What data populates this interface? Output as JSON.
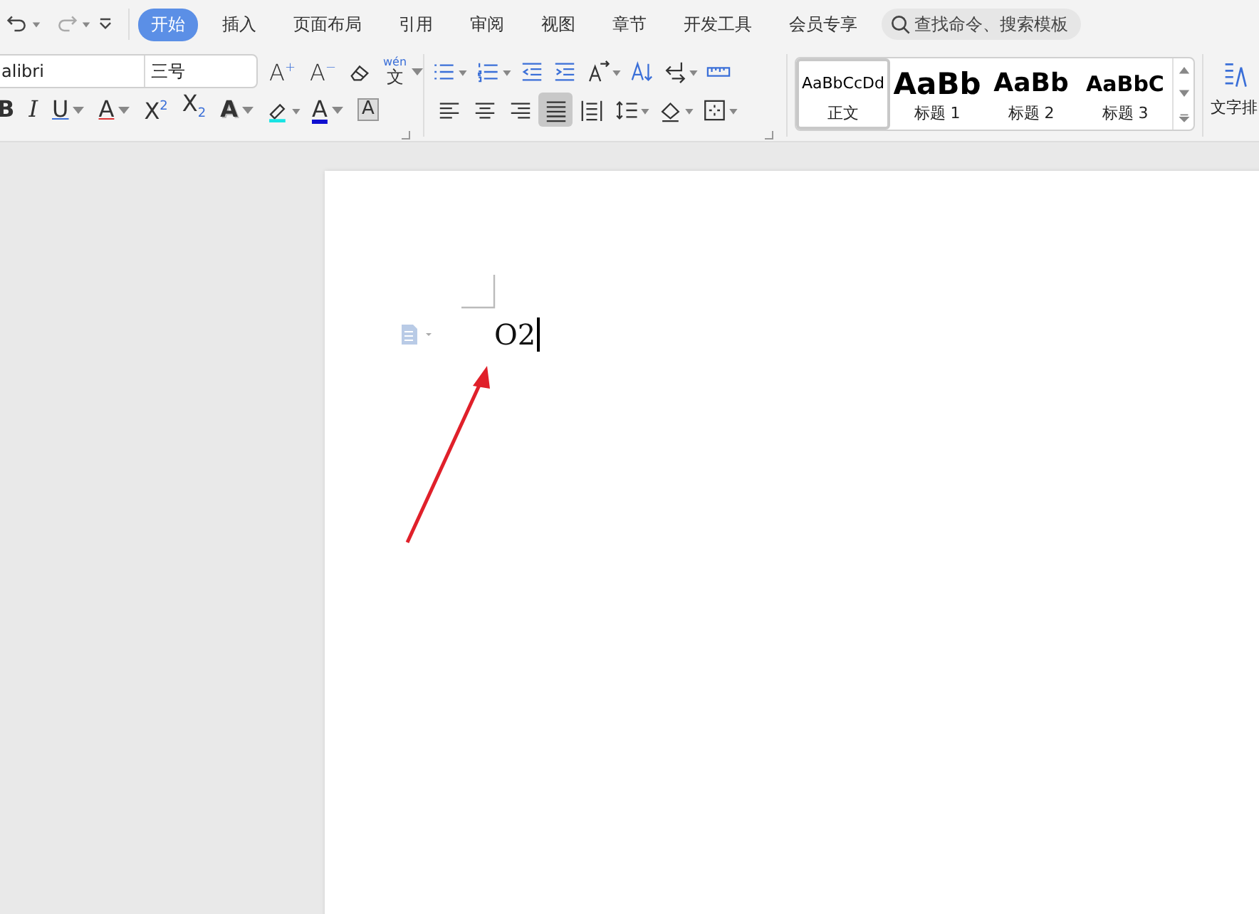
{
  "tabs": [
    {
      "label": "开始",
      "selected": true
    },
    {
      "label": "插入",
      "selected": false
    },
    {
      "label": "页面布局",
      "selected": false
    },
    {
      "label": "引用",
      "selected": false
    },
    {
      "label": "审阅",
      "selected": false
    },
    {
      "label": "视图",
      "selected": false
    },
    {
      "label": "章节",
      "selected": false
    },
    {
      "label": "开发工具",
      "selected": false
    },
    {
      "label": "会员专享",
      "selected": false
    }
  ],
  "search": {
    "placeholder": "查找命令、搜索模板"
  },
  "font": {
    "name": "alibri",
    "size": "三号"
  },
  "font_tools": [
    {
      "kind": "grow",
      "glyph": "A$^{+}$",
      "dropdown": false
    },
    {
      "kind": "shrink",
      "glyph": "A$^{−}$",
      "dropdown": false
    },
    {
      "kind": "eraser",
      "dropdown": false
    },
    {
      "kind": "phonetic",
      "top": "wén",
      "glyph": "文",
      "dropdown": true
    }
  ],
  "format_tools": [
    {
      "kind": "bold",
      "glyph": "B",
      "dropdown": false
    },
    {
      "kind": "italic",
      "glyph": "I",
      "dropdown": false
    },
    {
      "kind": "underline",
      "glyph": "U",
      "dropdown": true
    },
    {
      "kind": "strike",
      "glyph": "A",
      "dropdown": true
    },
    {
      "kind": "sup",
      "glyph": "X$^{2}$",
      "dropdown": false
    },
    {
      "kind": "sub",
      "glyph": "X$_{2}$",
      "dropdown": false
    },
    {
      "kind": "outline",
      "glyph": "A",
      "dropdown": true
    },
    {
      "kind": "highlight",
      "dropdown": true
    },
    {
      "kind": "color",
      "glyph": "A",
      "dropdown": true
    },
    {
      "kind": "shade",
      "glyph": "A",
      "dropdown": false
    }
  ],
  "paragraph_tools": [
    {
      "kind": "bullets",
      "dropdown": true
    },
    {
      "kind": "numbering",
      "dropdown": true
    },
    {
      "kind": "outdent",
      "dropdown": false
    },
    {
      "kind": "indent",
      "dropdown": false
    },
    {
      "kind": "direction",
      "dropdown": true
    },
    {
      "kind": "sort",
      "dropdown": false
    },
    {
      "kind": "linebreak",
      "dropdown": true
    },
    {
      "kind": "ruler",
      "dropdown": false
    }
  ],
  "align_tools": [
    {
      "kind": "left",
      "selected": false,
      "dropdown": false
    },
    {
      "kind": "center",
      "selected": false,
      "dropdown": false
    },
    {
      "kind": "right",
      "selected": false,
      "dropdown": false
    },
    {
      "kind": "justify",
      "selected": true,
      "dropdown": false
    },
    {
      "kind": "distribute",
      "selected": false,
      "dropdown": false
    },
    {
      "kind": "spacing",
      "selected": false,
      "dropdown": true
    },
    {
      "kind": "fill",
      "selected": false,
      "dropdown": true
    },
    {
      "kind": "border",
      "selected": false,
      "dropdown": true
    }
  ],
  "styles": [
    {
      "kind": "body",
      "sample": "AaBbCcDd",
      "label": "正文",
      "selected": true
    },
    {
      "kind": "h1",
      "sample": "AaBb",
      "label": "标题 1",
      "selected": false
    },
    {
      "kind": "h2",
      "sample": "AaBb",
      "label": "标题 2",
      "selected": false
    },
    {
      "kind": "h3",
      "sample": "AaBbC",
      "label": "标题 3",
      "selected": false
    }
  ],
  "text_layout": {
    "label": "文字排"
  },
  "document": {
    "text": "O2"
  }
}
